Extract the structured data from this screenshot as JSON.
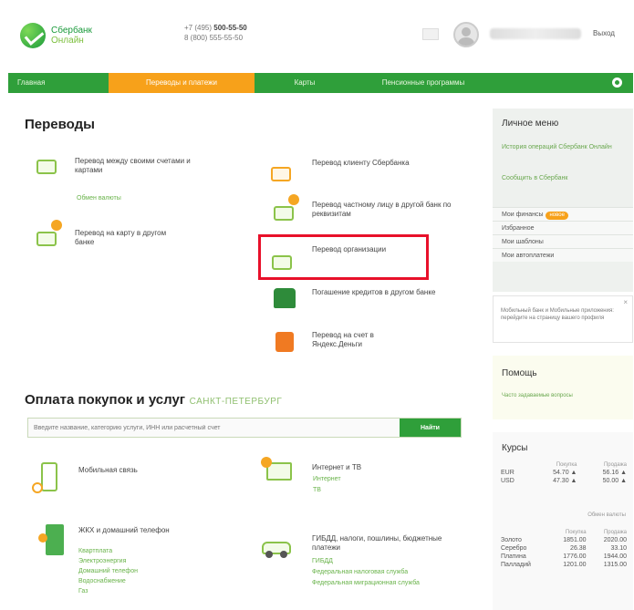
{
  "header": {
    "logo_line1": "Сбербанк",
    "logo_line2": "Онлайн",
    "phone1_prefix": "+7 (495)",
    "phone1_number": "500-55-50",
    "phone2_prefix": "8 (800)",
    "phone2_number": "555-55-50",
    "logout": "Выход"
  },
  "nav": {
    "items": [
      "Главная",
      "Переводы и платежи",
      "Карты",
      "Пенсионные программы"
    ]
  },
  "transfers": {
    "title": "Переводы",
    "left": [
      {
        "label": "Перевод между своими счетами и картами",
        "sub": "Обмен валюты"
      },
      {
        "label": "Перевод на карту в другом банке"
      }
    ],
    "right": [
      {
        "label": "Перевод клиенту Сбербанка"
      },
      {
        "label": "Перевод частному лицу в другой банк по реквизитам"
      },
      {
        "label": "Перевод организации"
      },
      {
        "label": "Погашение кредитов в другом банке"
      },
      {
        "label": "Перевод на счет в Яндекс.Деньги"
      }
    ]
  },
  "payments": {
    "title": "Оплата покупок и услуг",
    "region": "САНКТ-ПЕТЕРБУРГ",
    "search_placeholder": "Введите название, категорию услуги, ИНН или расчетный счет",
    "search_button": "Найти",
    "categories": [
      {
        "label": "Мобильная связь",
        "links": []
      },
      {
        "label": "Интернет и ТВ",
        "links": [
          "Интернет",
          "ТВ"
        ]
      },
      {
        "label": "ЖКХ и домашний телефон",
        "links": [
          "Квартплата",
          "Электроэнергия",
          "Домашний телефон",
          "Водоснабжение",
          "Газ"
        ]
      },
      {
        "label": "ГИБДД, налоги, пошлины, бюджетные платежи",
        "links": [
          "ГИБДД",
          "Федеральная налоговая служба",
          "Федеральная миграционная служба"
        ]
      }
    ]
  },
  "sidebar": {
    "menu_title": "Личное меню",
    "menu_links": [
      "История операций Сбербанк Онлайн",
      "Сообщить в Сбербанк"
    ],
    "menu_rows": [
      {
        "label": "Мои финансы",
        "badge": "новое"
      },
      {
        "label": "Избранное"
      },
      {
        "label": "Мои шаблоны"
      },
      {
        "label": "Мои автоплатежи"
      }
    ],
    "notice": "Мобильный банк и Мобильные приложения: перейдите на страницу вашего профиля",
    "help_title": "Помощь",
    "help_link": "Часто задаваемые вопросы",
    "rates_title": "Курсы",
    "rates_cols": [
      "Покупка",
      "Продажа"
    ],
    "rates": [
      {
        "cur": "EUR",
        "buy": "54.70 ▲",
        "sell": "56.16 ▲"
      },
      {
        "cur": "USD",
        "buy": "47.30 ▲",
        "sell": "50.00 ▲"
      }
    ],
    "rates_more": "Обмен валюты",
    "metals_cols": [
      "Покупка",
      "Продажа"
    ],
    "metals": [
      {
        "name": "Золото",
        "buy": "1851.00",
        "sell": "2020.00"
      },
      {
        "name": "Серебро",
        "buy": "26.38",
        "sell": "33.10"
      },
      {
        "name": "Платина",
        "buy": "1776.00",
        "sell": "1944.00"
      },
      {
        "name": "Палладий",
        "buy": "1201.00",
        "sell": "1315.00"
      }
    ]
  }
}
